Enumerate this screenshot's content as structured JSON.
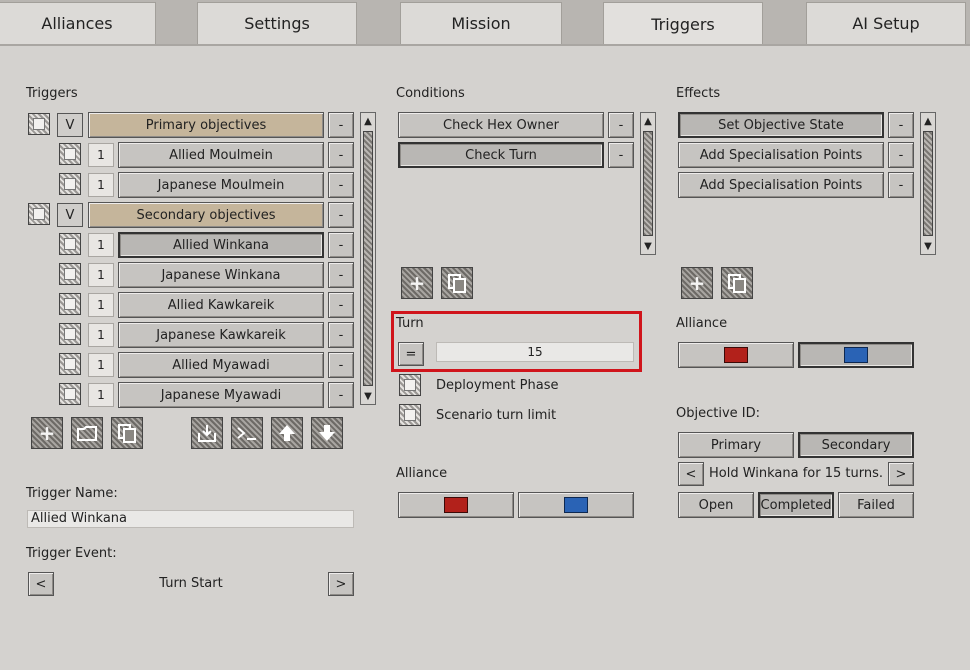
{
  "tabs": [
    {
      "label": "Alliances"
    },
    {
      "label": "Settings"
    },
    {
      "label": "Mission"
    },
    {
      "label": "Triggers"
    },
    {
      "label": "AI Setup"
    }
  ],
  "triggers": {
    "heading": "Triggers",
    "groups": [
      {
        "toggle": "V",
        "label": "Primary objectives",
        "remove": "-"
      },
      {
        "toggle": "V",
        "label": "Secondary objectives",
        "remove": "-"
      }
    ],
    "items": [
      {
        "count": "1",
        "label": "Allied Moulmein",
        "remove": "-"
      },
      {
        "count": "1",
        "label": "Japanese Moulmein",
        "remove": "-"
      },
      {
        "count": "1",
        "label": "Allied Winkana",
        "remove": "-"
      },
      {
        "count": "1",
        "label": "Japanese Winkana",
        "remove": "-"
      },
      {
        "count": "1",
        "label": "Allied Kawkareik",
        "remove": "-"
      },
      {
        "count": "1",
        "label": "Japanese Kawkareik",
        "remove": "-"
      },
      {
        "count": "1",
        "label": "Allied Myawadi",
        "remove": "-"
      },
      {
        "count": "1",
        "label": "Japanese Myawadi",
        "remove": "-"
      }
    ],
    "name_label": "Trigger Name:",
    "name_value": "Allied Winkana",
    "event_label": "Trigger Event:",
    "event_value": "Turn Start",
    "event_prev": "<",
    "event_next": ">"
  },
  "conditions": {
    "heading": "Conditions",
    "items": [
      {
        "label": "Check Hex Owner",
        "remove": "-"
      },
      {
        "label": "Check Turn",
        "remove": "-"
      }
    ],
    "turn_label": "Turn",
    "turn_operator": "=",
    "turn_value": "15",
    "deployment_label": "Deployment Phase",
    "scenario_limit_label": "Scenario turn limit",
    "alliance_label": "Alliance"
  },
  "effects": {
    "heading": "Effects",
    "items": [
      {
        "label": "Set Objective State",
        "remove": "-"
      },
      {
        "label": "Add Specialisation Points",
        "remove": "-"
      },
      {
        "label": "Add Specialisation Points",
        "remove": "-"
      }
    ],
    "alliance_label": "Alliance",
    "objective_id_label": "Objective ID:",
    "primary_label": "Primary",
    "secondary_label": "Secondary",
    "objective_text": "Hold Winkana for 15 turns.",
    "obj_prev": "<",
    "obj_next": ">",
    "open_label": "Open",
    "completed_label": "Completed",
    "failed_label": "Failed"
  },
  "colors": {
    "alliance_red": "#b2211b",
    "alliance_blue": "#2a63b5",
    "highlight": "#d0141b",
    "group_row": "#c5b59b"
  }
}
